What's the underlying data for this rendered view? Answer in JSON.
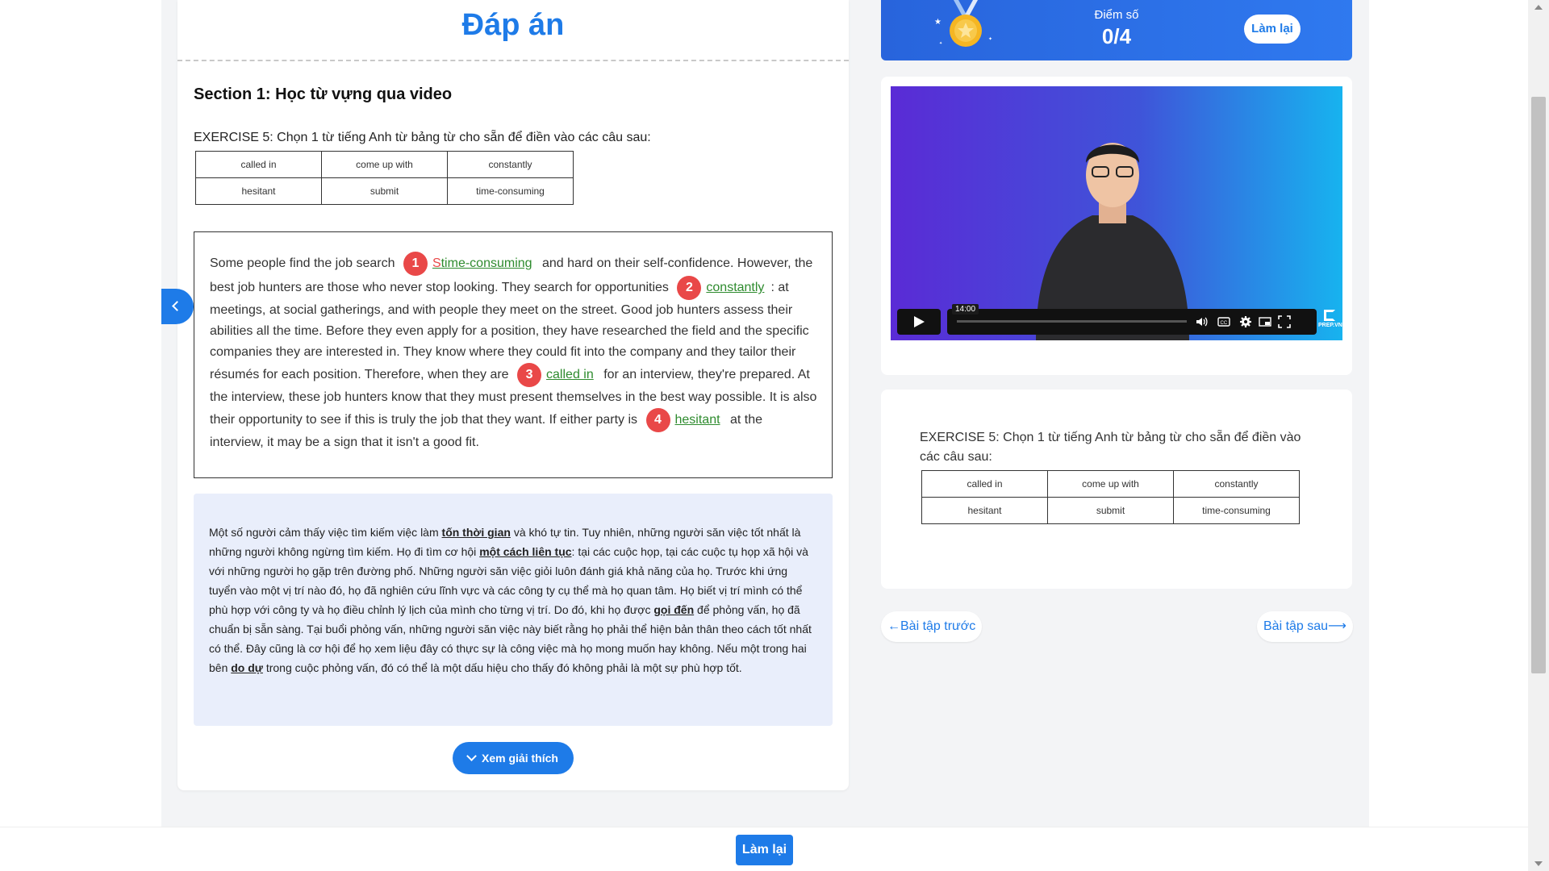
{
  "answer_title": "Đáp án",
  "section_title": "Section 1: Học từ vựng qua video",
  "exercise_label": "EXERCISE 5: Chọn 1 từ tiếng Anh từ bảng từ cho sẵn để điền vào các câu sau:",
  "word_table": [
    [
      "called in",
      "come up with",
      "constantly"
    ],
    [
      "hesitant",
      "submit",
      "time-consuming"
    ]
  ],
  "passage": {
    "t1": "Some people find the job search",
    "n1": "1",
    "a1_wrong": "S",
    "a1": "time-consuming",
    "t2": "and hard on their self-confidence. However, the best job hunters are those who never stop looking. They search for opportunities",
    "n2": "2",
    "a2": "constantly",
    "t3": ": at meetings, at social gatherings, and with people they meet on the street. Good job hunters assess their abilities all the time. Before they even apply for a position, they have researched the field and the specific companies they are interested in. They know where they could fit into the company and they tailor their résumés for each position. Therefore, when they are",
    "n3": "3",
    "a3": "called in",
    "t4": "for an interview, they're prepared. At the interview, these job hunters know that they must present themselves in the best way possible. It is also their opportunity to see if this is truly the job that they want. If either party is",
    "n4": "4",
    "a4": "hesitant",
    "t5": "at the interview, it may be a sign that it isn't a good fit."
  },
  "translation": {
    "p1": "Một số người cảm thấy việc tìm kiếm việc làm",
    "b1": "tốn thời gian",
    "p2": "và khó tự tin. Tuy nhiên, những người săn việc tốt nhất là những người không ngừng tìm kiếm. Họ đi tìm cơ hội",
    "b2": "một cách liên tục",
    "p3": ": tại các cuộc họp, tại các cuộc tụ họp xã hội và với những người họ gặp trên đường phố. Những người săn việc giỏi luôn đánh giá khả năng của họ. Trước khi ứng tuyển vào một vị trí nào đó, họ đã nghiên cứu lĩnh vực và các công ty cụ thể mà họ quan tâm. Họ biết vị trí mình có thể phù hợp với công ty và họ điều chỉnh lý lịch của mình cho từng vị trí. Do đó, khi họ được",
    "b3": "gọi đến",
    "p4": "để phỏng vấn, họ đã chuẩn bị sẵn sàng. Tại buổi phỏng vấn, những người săn việc này biết rằng họ phải thể hiện bản thân theo cách tốt nhất có thể. Đây cũng là cơ hội để họ xem liệu đây có thực sự là công việc mà họ mong muốn hay không. Nếu một trong hai bên",
    "b4": "do dự",
    "p5": "trong cuộc phỏng vấn, đó có thể là một dấu hiệu cho thấy đó không phải là một sự phù hợp tốt."
  },
  "explain_button": "Xem giải thích",
  "score": {
    "label": "Điểm số",
    "value": "0/4",
    "retry": "Làm lại"
  },
  "video": {
    "time_tip": "14:00",
    "brand": "PREP.VN"
  },
  "exercise_card_text": "EXERCISE 5: Chọn 1 từ tiếng Anh từ bảng từ cho sẵn để điền vào các câu sau:",
  "nav": {
    "prev": "←Bài tập trước",
    "next": "Bài tập sau⟶"
  },
  "footer": {
    "retry": "Làm lại"
  },
  "colors": {
    "accent": "#1e7be8",
    "correct": "#2e8b2e",
    "marker": "#e94848"
  }
}
